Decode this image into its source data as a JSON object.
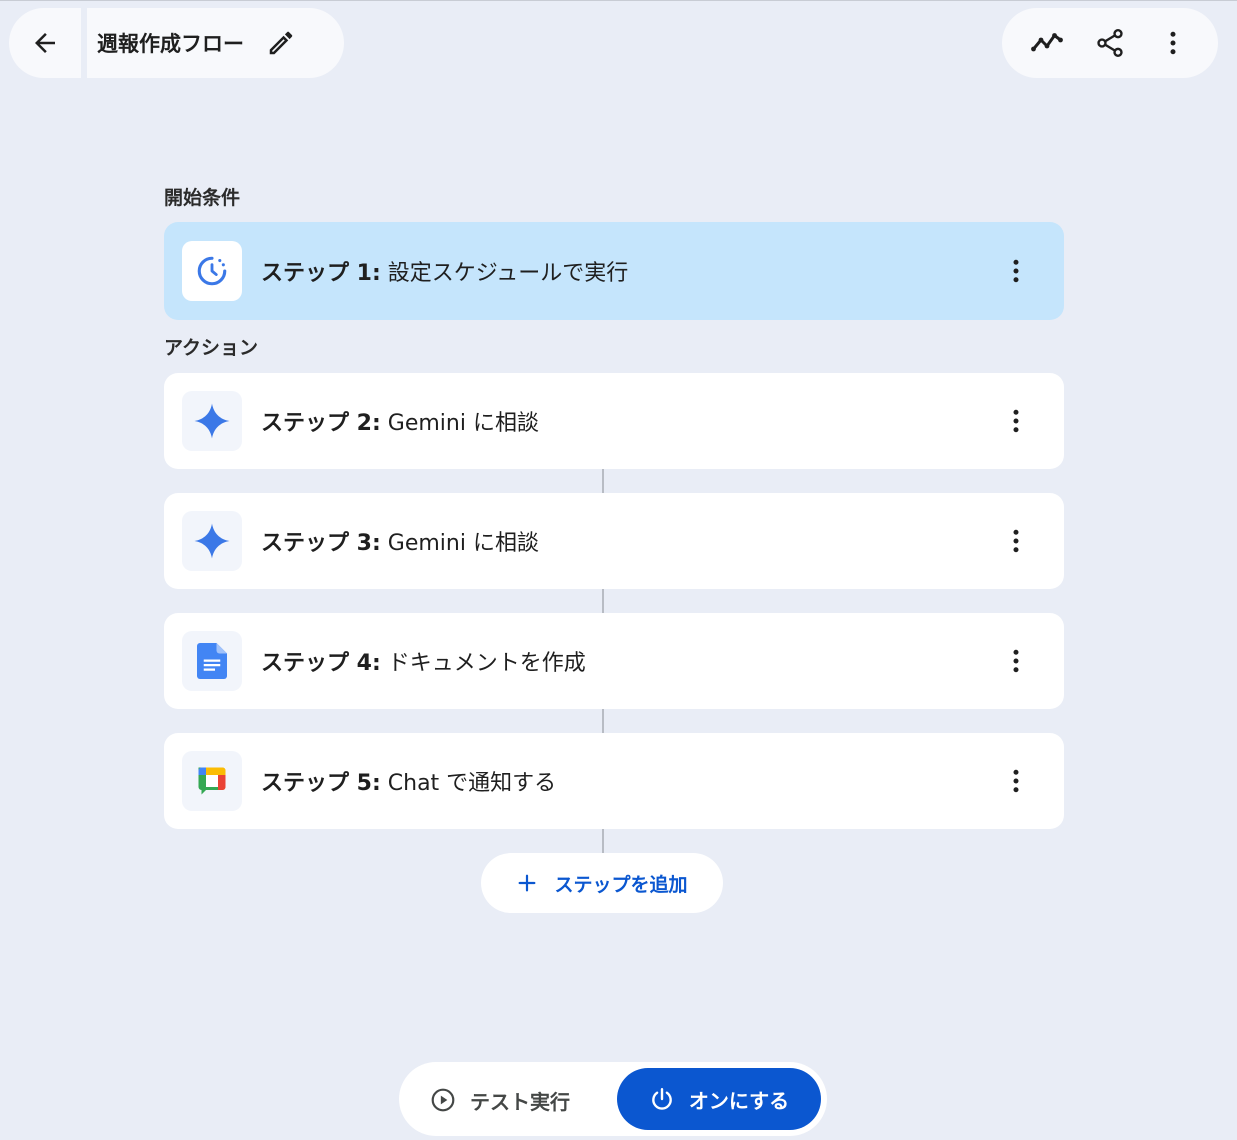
{
  "header": {
    "title": "週報作成フロー",
    "icons": {
      "back": "arrow-back-icon",
      "edit": "pencil-icon",
      "activity": "activity-chart-icon",
      "share": "share-icon",
      "more": "more-vertical-icon"
    }
  },
  "starter": {
    "section_label": "開始条件",
    "step": {
      "prefix": "ステップ 1:",
      "title": "設定スケジュールで実行",
      "icon": "schedule-clock-icon",
      "selected": true
    }
  },
  "actions": {
    "section_label": "アクション",
    "steps": [
      {
        "prefix": "ステップ 2:",
        "title": "Gemini に相談",
        "icon": "gemini-sparkle-icon"
      },
      {
        "prefix": "ステップ 3:",
        "title": "Gemini に相談",
        "icon": "gemini-sparkle-icon"
      },
      {
        "prefix": "ステップ 4:",
        "title": "ドキュメントを作成",
        "icon": "google-docs-icon"
      },
      {
        "prefix": "ステップ 5:",
        "title": "Chat で通知する",
        "icon": "google-chat-icon"
      }
    ]
  },
  "add_step": {
    "label": "ステップを追加",
    "icon": "plus-icon"
  },
  "bottom": {
    "test_run_label": "テスト実行",
    "test_run_icon": "play-circle-icon",
    "turn_on_label": "オンにする",
    "turn_on_icon": "power-icon"
  },
  "colors": {
    "background": "#e9edf6",
    "selected_card": "#c5e5fc",
    "primary_blue": "#0b57d0",
    "gemini_blue": "#3b78e7"
  }
}
